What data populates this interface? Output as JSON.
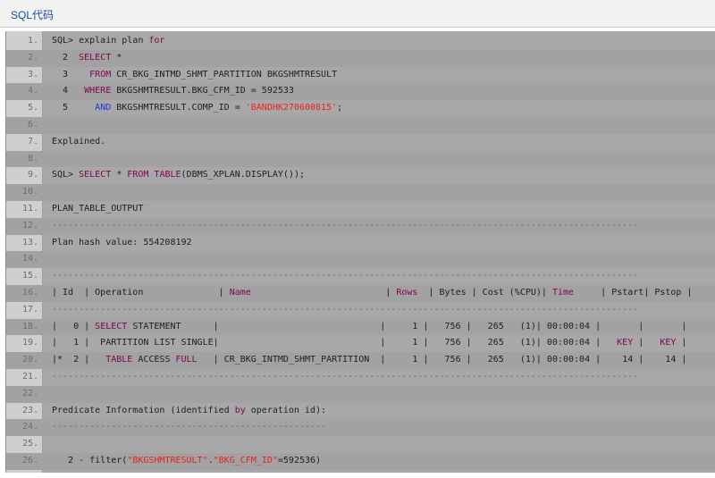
{
  "header": {
    "title": "SQL代码"
  },
  "code": {
    "line_numbers": [
      "1.",
      "2.",
      "3.",
      "4.",
      "5.",
      "6.",
      "7.",
      "8.",
      "9.",
      "10.",
      "11.",
      "12.",
      "13.",
      "14.",
      "15.",
      "16.",
      "17.",
      "18.",
      "19.",
      "20.",
      "21.",
      "22.",
      "23.",
      "24.",
      "25.",
      "26."
    ],
    "lines": [
      {
        "segments": [
          {
            "t": "SQL> explain plan ",
            "c": "plain"
          },
          {
            "t": "for",
            "c": "kw"
          }
        ]
      },
      {
        "segments": [
          {
            "t": "  2  ",
            "c": "plain"
          },
          {
            "t": "SELECT",
            "c": "kw"
          },
          {
            "t": " *",
            "c": "plain"
          }
        ]
      },
      {
        "segments": [
          {
            "t": "  3    ",
            "c": "plain"
          },
          {
            "t": "FROM",
            "c": "kw"
          },
          {
            "t": " CR_BKG_INTMD_SHMT_PARTITION BKGSHMTRESULT",
            "c": "plain"
          }
        ]
      },
      {
        "segments": [
          {
            "t": "  4   ",
            "c": "plain"
          },
          {
            "t": "WHERE",
            "c": "kw"
          },
          {
            "t": " BKGSHMTRESULT.BKG_CFM_ID = 592533",
            "c": "plain"
          }
        ]
      },
      {
        "segments": [
          {
            "t": "  5     ",
            "c": "plain"
          },
          {
            "t": "AND",
            "c": "kw2"
          },
          {
            "t": " BKGSHMTRESULT.COMP_ID = ",
            "c": "plain"
          },
          {
            "t": "'BANDHK270600815'",
            "c": "str"
          },
          {
            "t": ";",
            "c": "plain"
          }
        ]
      },
      {
        "segments": []
      },
      {
        "segments": [
          {
            "t": "Explained.",
            "c": "plain"
          }
        ]
      },
      {
        "segments": []
      },
      {
        "segments": [
          {
            "t": "SQL> ",
            "c": "plain"
          },
          {
            "t": "SELECT",
            "c": "kw"
          },
          {
            "t": " * ",
            "c": "plain"
          },
          {
            "t": "FROM",
            "c": "kw"
          },
          {
            "t": " ",
            "c": "plain"
          },
          {
            "t": "TABLE",
            "c": "kw"
          },
          {
            "t": "(DBMS_XPLAN.DISPLAY());",
            "c": "plain"
          }
        ]
      },
      {
        "segments": []
      },
      {
        "segments": [
          {
            "t": "PLAN_TABLE_OUTPUT",
            "c": "plain"
          }
        ]
      },
      {
        "segments": [
          {
            "t": "-------------------------------------------------------------------------------------------------------------",
            "c": "dash"
          }
        ]
      },
      {
        "segments": [
          {
            "t": "Plan hash value: 554208192",
            "c": "plain"
          }
        ]
      },
      {
        "segments": []
      },
      {
        "segments": [
          {
            "t": "-------------------------------------------------------------------------------------------------------------",
            "c": "dash"
          }
        ]
      },
      {
        "segments": [
          {
            "t": "| Id  | Operation              | ",
            "c": "plain"
          },
          {
            "t": "Name",
            "c": "kw"
          },
          {
            "t": "                         | ",
            "c": "plain"
          },
          {
            "t": "Rows",
            "c": "kw"
          },
          {
            "t": "  | Bytes | Cost (%CPU)| ",
            "c": "plain"
          },
          {
            "t": "Time",
            "c": "kw"
          },
          {
            "t": "     | Pstart| Pstop |",
            "c": "plain"
          }
        ]
      },
      {
        "segments": [
          {
            "t": "-------------------------------------------------------------------------------------------------------------",
            "c": "dash"
          }
        ]
      },
      {
        "segments": [
          {
            "t": "|   0 | ",
            "c": "plain"
          },
          {
            "t": "SELECT",
            "c": "kw"
          },
          {
            "t": " STATEMENT      |                              |     1 |   756 |   265   (1)| 00:00:04 |       |       |",
            "c": "plain"
          }
        ]
      },
      {
        "segments": [
          {
            "t": "|   1 |  PARTITION LIST SINGLE|                              |     1 |   756 |   265   (1)| 00:00:04 |   ",
            "c": "plain"
          },
          {
            "t": "KEY",
            "c": "kw"
          },
          {
            "t": " |   ",
            "c": "plain"
          },
          {
            "t": "KEY",
            "c": "kw"
          },
          {
            "t": " |",
            "c": "plain"
          }
        ]
      },
      {
        "segments": [
          {
            "t": "|*  2 |   ",
            "c": "plain"
          },
          {
            "t": "TABLE",
            "c": "kw"
          },
          {
            "t": " ACCESS ",
            "c": "plain"
          },
          {
            "t": "FULL",
            "c": "kw"
          },
          {
            "t": "   | CR_BKG_INTMD_SHMT_PARTITION  |     1 |   756 |   265   (1)| 00:00:04 |    14 |    14 |",
            "c": "plain"
          }
        ]
      },
      {
        "segments": [
          {
            "t": "-------------------------------------------------------------------------------------------------------------",
            "c": "dash"
          }
        ]
      },
      {
        "segments": []
      },
      {
        "segments": [
          {
            "t": "Predicate Information (identified ",
            "c": "plain"
          },
          {
            "t": "by",
            "c": "kw"
          },
          {
            "t": " operation id):",
            "c": "plain"
          }
        ]
      },
      {
        "segments": [
          {
            "t": "---------------------------------------------------",
            "c": "dash"
          }
        ]
      },
      {
        "segments": []
      },
      {
        "segments": [
          {
            "t": "   2 - filter(",
            "c": "plain"
          },
          {
            "t": "\"BKGSHMTRESULT\"",
            "c": "str"
          },
          {
            "t": ".",
            "c": "plain"
          },
          {
            "t": "\"BKG_CFM_ID\"",
            "c": "str"
          },
          {
            "t": "=592536)",
            "c": "plain"
          }
        ]
      }
    ]
  },
  "colors": {
    "header_bg": "#f2f2f2",
    "header_text": "#1a4a9c",
    "code_bg": "#a8a8a8",
    "gutter_bg": "#cfcfcf",
    "keyword": "#7d0552",
    "keyword_blue": "#1c38d8",
    "string": "#ef1f1f",
    "dash": "#2d8f3c"
  }
}
